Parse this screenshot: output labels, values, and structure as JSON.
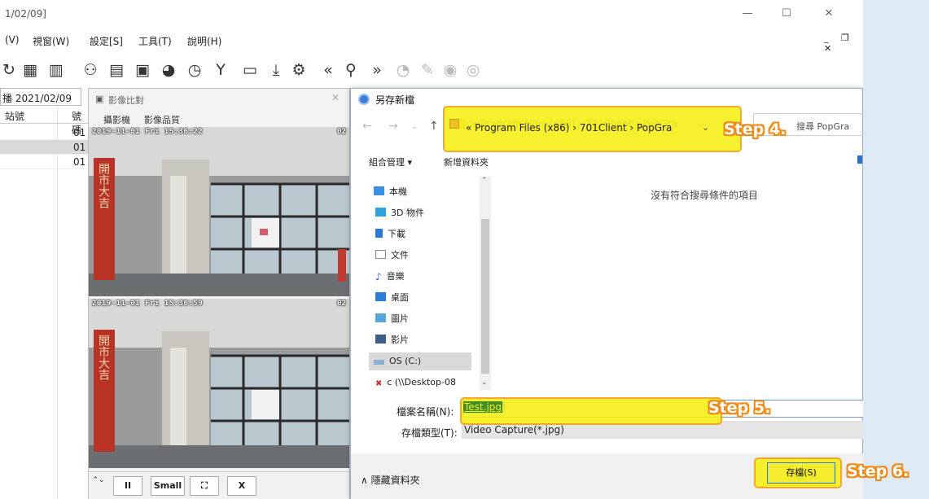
{
  "window": {
    "title": "1/02/09]",
    "min": "—",
    "max": "☐",
    "close": "✕"
  },
  "menu": [
    "(V)",
    "視窗(W)",
    "設定[S]",
    "工具(T)",
    "說明(H)"
  ],
  "mdi_controls": "_ ❐ ✕",
  "left_pane": {
    "tab_label": "播 2021/02/09",
    "col1": "站號",
    "col2": "號碼",
    "rows": [
      "01",
      "01",
      "01"
    ]
  },
  "video_panel": {
    "title": "影像比對",
    "tabs": [
      "攝影機",
      "影像品質"
    ],
    "videos": [
      {
        "timestamp": "2019-11-01 Fri 15:36:22",
        "camera": "02",
        "sign": "開市大吉"
      },
      {
        "timestamp": "2019-11-01 Fri 15:36:59",
        "camera": "02",
        "sign": "開市大吉"
      }
    ],
    "controls": [
      "⌃⌄",
      "II",
      "Small",
      "⛶",
      "X"
    ]
  },
  "dialog": {
    "title": "另存新檔",
    "address": "« Program Files (x86) › 701Client › PopGra",
    "search_placeholder": "搜尋 PopGra",
    "organize": "組合管理 ▾",
    "new_folder": "新增資料夾",
    "tree": [
      {
        "label": "本機",
        "icon": "computer-icon",
        "color": "#3a8ee6"
      },
      {
        "label": "3D 物件",
        "icon": "cube-icon",
        "color": "#2fa3e0"
      },
      {
        "label": "下載",
        "icon": "download-icon",
        "color": "#2a7ad8"
      },
      {
        "label": "文件",
        "icon": "document-icon",
        "color": "#7e8c9c"
      },
      {
        "label": "音樂",
        "icon": "music-icon",
        "color": "#2b6fd6"
      },
      {
        "label": "桌面",
        "icon": "desktop-icon",
        "color": "#2a7fd8"
      },
      {
        "label": "圖片",
        "icon": "picture-icon",
        "color": "#5aa6da"
      },
      {
        "label": "影片",
        "icon": "video-icon",
        "color": "#3d5d8c"
      },
      {
        "label": "OS (C:)",
        "icon": "drive-icon",
        "color": "#8ab0d8"
      },
      {
        "label": "c (\\\\Desktop-08",
        "icon": "network-drive-icon",
        "color": "#c83030"
      }
    ],
    "empty_message": "沒有符合搜尋條件的項目",
    "filename_label": "檔案名稱(N):",
    "filename_value": "Test.jpg",
    "filetype_label": "存檔類型(T):",
    "filetype_value": "Video Capture(*.jpg)",
    "hide_folders": "∧ 隱藏資料夾",
    "save_label": "存檔(S)"
  },
  "annotations": {
    "step4": "Step 4.",
    "step5": "Step 5.",
    "step6": "Step 6.",
    "highlight_color": "#f7ef1e",
    "outline_color": "#f2a21a"
  }
}
